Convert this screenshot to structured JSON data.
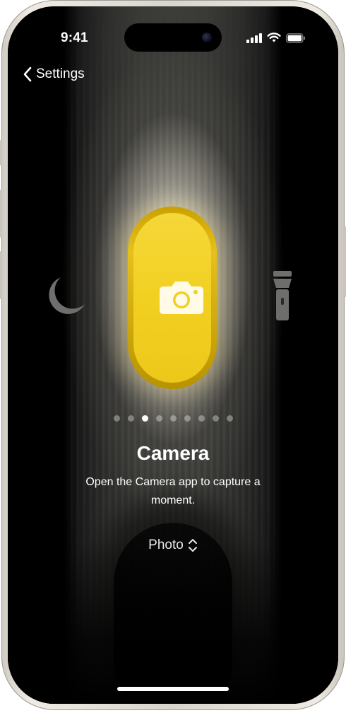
{
  "status_bar": {
    "time": "9:41",
    "icons": [
      "cellular-signal-icon",
      "wifi-icon",
      "battery-icon"
    ]
  },
  "nav": {
    "back_label": "Settings"
  },
  "action_button": {
    "icon": "camera-icon",
    "color": "#f3d22a"
  },
  "side_actions": {
    "left_icon": "moon-icon",
    "right_icon": "flashlight-icon"
  },
  "page_indicator": {
    "count": 9,
    "active_index": 2
  },
  "action": {
    "title": "Camera",
    "description": "Open the Camera app to capture a moment.",
    "option_value": "Photo"
  }
}
